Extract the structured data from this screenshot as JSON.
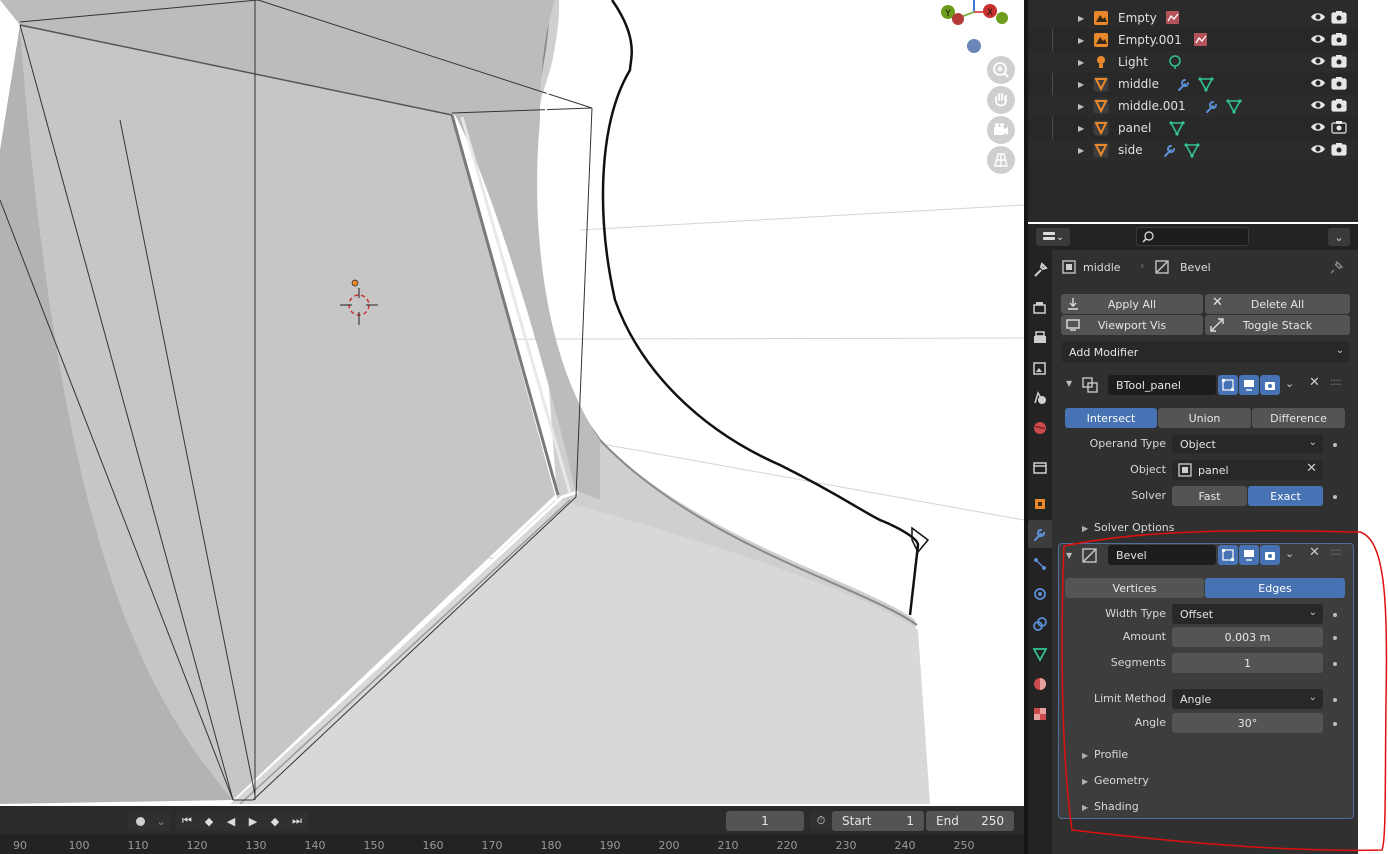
{
  "outliner": {
    "items": [
      {
        "name": "Empty",
        "type": "empty"
      },
      {
        "name": "Empty.001",
        "type": "empty"
      },
      {
        "name": "Light",
        "type": "light"
      },
      {
        "name": "middle",
        "type": "mesh",
        "modifier": true
      },
      {
        "name": "middle.001",
        "type": "mesh",
        "modifier": true
      },
      {
        "name": "panel",
        "type": "mesh",
        "modifier": false
      },
      {
        "name": "side",
        "type": "mesh",
        "modifier": true
      }
    ]
  },
  "properties": {
    "breadcrumb": {
      "object": "middle",
      "modifier": "Bevel"
    },
    "toolbar": {
      "apply_all": "Apply All",
      "delete_all": "Delete All",
      "viewport_vis": "Viewport Vis",
      "toggle_stack": "Toggle Stack"
    },
    "add_modifier": "Add Modifier",
    "boolean": {
      "name": "BTool_panel",
      "ops": [
        "Intersect",
        "Union",
        "Difference"
      ],
      "active_op": "Intersect",
      "operand_type_label": "Operand Type",
      "operand_type": "Object",
      "object_label": "Object",
      "object": "panel",
      "solver_label": "Solver",
      "solver_fast": "Fast",
      "solver_exact": "Exact",
      "solver_options": "Solver Options"
    },
    "bevel": {
      "name": "Bevel",
      "affect_vertices": "Vertices",
      "affect_edges": "Edges",
      "width_type_label": "Width Type",
      "width_type": "Offset",
      "amount_label": "Amount",
      "amount": "0.003 m",
      "segments_label": "Segments",
      "segments": "1",
      "limit_method_label": "Limit Method",
      "limit_method": "Angle",
      "angle_label": "Angle",
      "angle": "30°",
      "subpanels": [
        "Profile",
        "Geometry",
        "Shading"
      ]
    }
  },
  "timeline": {
    "current_frame": "1",
    "start_label": "Start",
    "start": "1",
    "end_label": "End",
    "end": "250",
    "ruler_ticks": [
      "90",
      "100",
      "110",
      "120",
      "130",
      "140",
      "150",
      "160",
      "170",
      "180",
      "190",
      "200",
      "210",
      "220",
      "230",
      "240",
      "250"
    ]
  },
  "gizmo": {
    "y_label": "Y",
    "x_label": "X"
  },
  "colors": {
    "accent": "#4772b3",
    "annotation": "#e01010",
    "modifier_icon": "#5d8fd6",
    "mesh_data": "#33c290",
    "object_orange": "#e8882b"
  }
}
